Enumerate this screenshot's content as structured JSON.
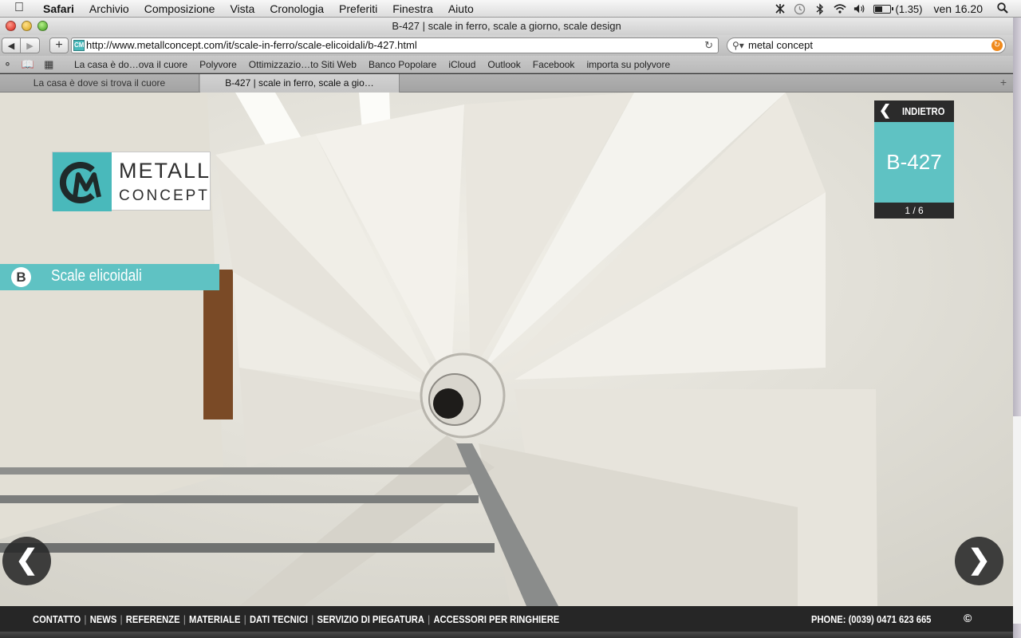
{
  "menubar": {
    "apple_icon": "apple-logo-icon",
    "items": [
      "Safari",
      "Archivio",
      "Composizione",
      "Vista",
      "Cronologia",
      "Preferiti",
      "Finestra",
      "Aiuto"
    ],
    "battery_text": "(1.35)",
    "battery_level": 0.55,
    "clock": "ven 16.20"
  },
  "window": {
    "title": "B-427 | scale in ferro, scale a giorno, scale design"
  },
  "toolbar": {
    "url": "http://www.metallconcept.com/it/scale-in-ferro/scale-elicoidali/b-427.html",
    "search_value": "metal concept"
  },
  "bookmarks": [
    "La casa è do…ova il cuore",
    "Polyvore",
    "Ottimizzazio…to Siti Web",
    "Banco Popolare",
    "iCloud",
    "Outlook",
    "Facebook",
    "importa su polyvore"
  ],
  "tabs": [
    {
      "label": "La casa è dove si trova il cuore",
      "active": false
    },
    {
      "label": "B-427 | scale in ferro, scale a gio…",
      "active": true
    }
  ],
  "page": {
    "brand_primary": "METALL",
    "brand_secondary": "CONCEPT",
    "category_letter": "B",
    "category_label": "Scale elicoidali",
    "back_label": "INDIETRO",
    "product_code": "B-427",
    "counter": "1 / 6",
    "accent_color": "#5fc2c3",
    "dark_color": "#2b2b2b"
  },
  "footer": {
    "links": [
      "CONTATTO",
      "NEWS",
      "REFERENZE",
      "MATERIALE",
      "DATI TECNICI",
      "SERVIZIO DI PIEGATURA",
      "ACCESSORI PER RINGHIERE"
    ],
    "phone": "PHONE: (0039) 0471 623 665",
    "copyright": "©"
  }
}
